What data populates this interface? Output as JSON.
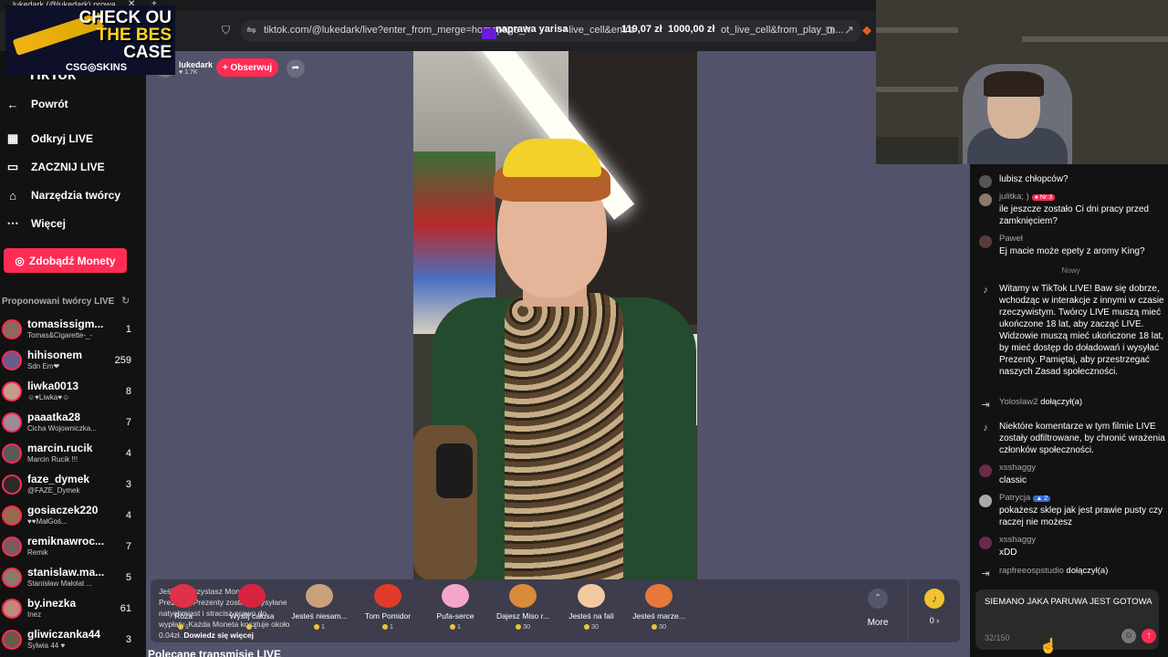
{
  "browser": {
    "tab_title": "lukedark (@lukedark) prowa...",
    "url": "tiktok.com/@lukedark/live?enter_from_merge=homepage_h",
    "url_tail": "=live_cell&entra",
    "url_tail2": "ot_live_cell&from_play_m...",
    "overlay_donor": "naprawa yarisa",
    "overlay_amount1": "119,07 zł",
    "overlay_amount2": "1000,00 zł"
  },
  "promo": {
    "line1": "CHECK OU",
    "line2": "THE BES",
    "line3": "CASE",
    "brand": "CSG◎SKINS"
  },
  "sidebar": {
    "logo": "TikTok",
    "nav": [
      {
        "label": "Powrót",
        "icon": "arrow-left-icon"
      },
      {
        "label": "Odkryj LIVE",
        "icon": "calendar-icon"
      },
      {
        "label": "ZACZNIJ LIVE",
        "icon": "camera-icon"
      },
      {
        "label": "Narzędzia twórcy",
        "icon": "home-icon"
      },
      {
        "label": "Więcej",
        "icon": "more-icon"
      }
    ],
    "coins_button": "Zdobądź Monety",
    "suggested_title": "Proponowani twórcy LIVE",
    "creators": [
      {
        "name": "tomasissigm...",
        "sub": "Tomas&Cigarette-_-",
        "count": "1",
        "color": "#8a6a5a"
      },
      {
        "name": "hihisonem",
        "sub": "Sdn Em❤",
        "count": "259",
        "color": "#6b5a8a"
      },
      {
        "name": "liwka0013",
        "sub": "☺♥Liwka♥☺",
        "count": "8",
        "color": "#c79a8a"
      },
      {
        "name": "paaatka28",
        "sub": "Cicha Wojowniczka...",
        "count": "7",
        "color": "#a08a9a"
      },
      {
        "name": "marcin.rucik",
        "sub": "Marcin Rucik !!!",
        "count": "4",
        "color": "#5a5a5a"
      },
      {
        "name": "faze_dymek",
        "sub": "@FAZE_Dymek",
        "count": "3",
        "color": "#2a2a2a"
      },
      {
        "name": "gosiaczek220",
        "sub": "♥♥MałGoś...",
        "count": "4",
        "color": "#9a6a4a"
      },
      {
        "name": "remiknawroc...",
        "sub": "Remik",
        "count": "7",
        "color": "#7a5a5a"
      },
      {
        "name": "stanislaw.ma...",
        "sub": "Stanisław Małolat ...",
        "count": "5",
        "color": "#8a7a6a"
      },
      {
        "name": "by.inezka",
        "sub": "Inez",
        "count": "61",
        "color": "#c08a7a"
      },
      {
        "name": "gliwiczanka44",
        "sub": "Sylwia 44 ♥",
        "count": "3",
        "color": "#6a5a4a"
      }
    ]
  },
  "stage": {
    "streamer_name": "lukedark",
    "streamer_likes": "♥ 1.7K",
    "follow_label": "+ Obserwuj",
    "bottom_heading": "Polecane transmisje LIVE"
  },
  "gifts": {
    "info_text": "Jeśli wykorzystasz Monety na Prezenty, Prezenty zostaną wysyłane natychmiast i stracisz prawo do wypłaty. Każda Moneta kosztuje około 0.04zł.",
    "info_link": "Dowiedz się więcej",
    "items": [
      {
        "name": "Róża",
        "price": "1",
        "color": "#e0304a"
      },
      {
        "name": "Wyślij całusa",
        "price": "1",
        "color": "#d8233f"
      },
      {
        "name": "Jesteś niesam...",
        "price": "1",
        "color": "#c9a27a"
      },
      {
        "name": "Tom Pomidor",
        "price": "1",
        "color": "#e03a2a"
      },
      {
        "name": "Pufa-serce",
        "price": "1",
        "color": "#f4a6c8"
      },
      {
        "name": "Dajesz Miso r...",
        "price": "30",
        "color": "#d98a3a"
      },
      {
        "name": "Jesteś na fali",
        "price": "30",
        "color": "#f3c9a0"
      },
      {
        "name": "Jesteś marze...",
        "price": "30",
        "color": "#e6783a"
      }
    ],
    "more_label": "More",
    "balance": "0"
  },
  "chat": {
    "messages": [
      {
        "user": "",
        "text": "lubisz chłopców?",
        "kind": "avatar",
        "color": "#555"
      },
      {
        "user": "julitka; )",
        "badge": "● Nr 3",
        "badge_color": "#fe2c55",
        "text": "ile jeszcze zostało Ci dni pracy przed zamknięciem?",
        "kind": "avatar",
        "color": "#8a7a6a"
      },
      {
        "user": "Paweł",
        "text": "Ej macie może epety z aromy King?",
        "kind": "avatar",
        "color": "#5a3a3a"
      },
      {
        "user": "",
        "text": "Witamy w TikTok LIVE! Baw się dobrze, wchodząc w interakcje z innymi w czasie rzeczywistym. Twórcy LIVE muszą mieć ukończone 18 lat, aby zacząć LIVE. Widzowie muszą mieć ukończone 18 lat, by mieć dostęp do doładowań i wysyłać Prezenty. Pamiętaj, aby przestrzegać naszych Zasad społeczności.",
        "kind": "tiktok"
      },
      {
        "user": "Yoloslaw2",
        "text": "dołączył(a)",
        "kind": "join"
      },
      {
        "user": "",
        "text": "Niektóre komentarze w tym filmie LIVE zostały odfiltrowane, by chronić wrażenia członków społeczności.",
        "kind": "tiktok"
      },
      {
        "user": "xsshaggy",
        "text": "classic",
        "kind": "avatar",
        "color": "#6a2a4a"
      },
      {
        "user": "Patrycja",
        "badge": "▲ 2",
        "badge_color": "#3a6ad8",
        "text": "pokażesz sklep jak jest prawie pusty czy raczej nie możesz",
        "kind": "avatar",
        "color": "#aaa"
      },
      {
        "user": "xsshaggy",
        "text": "xDD",
        "kind": "avatar",
        "color": "#6a2a4a"
      },
      {
        "user": "rapfreeospstudio",
        "text": "dołączył(a)",
        "kind": "join"
      }
    ],
    "new_separator": "Nowy",
    "input_text": "SIEMANO JAKA PARUWA JEST GOTOWA",
    "input_count": "32/150"
  }
}
